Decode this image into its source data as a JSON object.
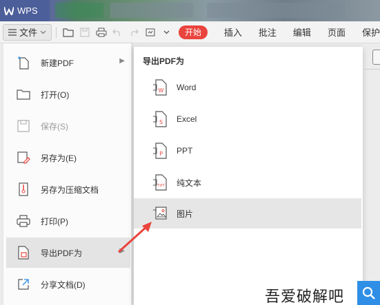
{
  "titlebar": {
    "app_name": "WPS"
  },
  "toolbar": {
    "file_label": "文件",
    "start_label": "开始",
    "tabs": [
      "插入",
      "批注",
      "编辑",
      "页面",
      "保护"
    ]
  },
  "file_menu": {
    "items": [
      {
        "label": "新建PDF",
        "icon": "new-pdf-icon",
        "has_submenu": true,
        "disabled": false
      },
      {
        "label": "打开(O)",
        "icon": "folder-open-icon",
        "has_submenu": false,
        "disabled": false
      },
      {
        "label": "保存(S)",
        "icon": "save-icon",
        "has_submenu": false,
        "disabled": true
      },
      {
        "label": "另存为(E)",
        "icon": "save-as-icon",
        "has_submenu": false,
        "disabled": false
      },
      {
        "label": "另存为压缩文档",
        "icon": "compress-icon",
        "has_submenu": false,
        "disabled": false
      },
      {
        "label": "打印(P)",
        "icon": "print-icon",
        "has_submenu": false,
        "disabled": false
      },
      {
        "label": "导出PDF为",
        "icon": "export-pdf-icon",
        "has_submenu": true,
        "disabled": false,
        "active": true
      },
      {
        "label": "分享文档(D)",
        "icon": "share-icon",
        "has_submenu": false,
        "disabled": false
      }
    ]
  },
  "export_submenu": {
    "title": "导出PDF为",
    "items": [
      {
        "label": "Word",
        "icon": "export-word-icon"
      },
      {
        "label": "Excel",
        "icon": "export-excel-icon"
      },
      {
        "label": "PPT",
        "icon": "export-ppt-icon"
      },
      {
        "label": "纯文本",
        "icon": "export-txt-icon"
      },
      {
        "label": "图片",
        "icon": "export-image-icon",
        "hover": true
      }
    ]
  },
  "watermark": {
    "text": "吾爱破解吧"
  },
  "colors": {
    "accent_red": "#e9443d",
    "title_blue": "#4d5f9a",
    "search_blue": "#2f8fe6"
  }
}
